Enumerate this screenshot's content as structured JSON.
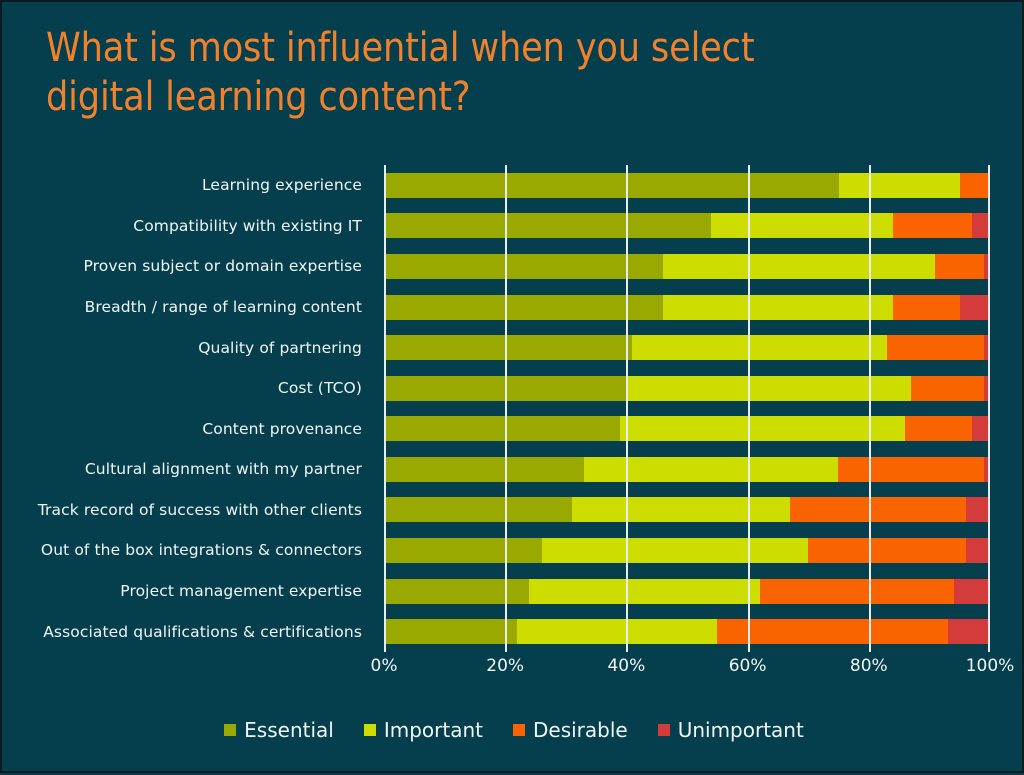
{
  "title": "What is most influential when you select\ndigital learning content?",
  "colors": {
    "background": "#053f4d",
    "title": "#f2812c",
    "text": "#f1f6f7",
    "gridline": "#e8eef0",
    "essential": "#9aa900",
    "important": "#cddd00",
    "desirable": "#fa6400",
    "unimportant": "#d43b3b"
  },
  "legend": [
    {
      "label": "Essential",
      "color": "#9aa900",
      "key": "essential"
    },
    {
      "label": "Important",
      "color": "#cddd00",
      "key": "important"
    },
    {
      "label": "Desirable",
      "color": "#fa6400",
      "key": "desirable"
    },
    {
      "label": "Unimportant",
      "color": "#d43b3b",
      "key": "unimportant"
    }
  ],
  "xticks": [
    "0%",
    "20%",
    "40%",
    "60%",
    "80%",
    "100%"
  ],
  "chart_data": {
    "type": "bar",
    "orientation": "horizontal",
    "stacked": true,
    "normalized": "percent",
    "title": "What is most influential when you select digital learning content?",
    "xlabel": "",
    "ylabel": "",
    "xlim": [
      0,
      100
    ],
    "xticks": [
      0,
      20,
      40,
      60,
      80,
      100
    ],
    "xticklabels": [
      "0%",
      "20%",
      "40%",
      "60%",
      "80%",
      "100%"
    ],
    "grid": "vertical",
    "legend_position": "bottom",
    "categories": [
      "Learning experience",
      "Compatibility with existing IT",
      "Proven subject or domain expertise",
      "Breadth / range of learning content",
      "Quality of partnering",
      "Cost (TCO)",
      "Content provenance",
      "Cultural alignment with my partner",
      "Track record of success with other clients",
      "Out of the box integrations & connectors",
      "Project management expertise",
      "Associated qualifications & certifications"
    ],
    "series": [
      {
        "name": "Essential",
        "color": "#9aa900",
        "values": [
          75,
          54,
          46,
          46,
          41,
          40,
          39,
          33,
          31,
          26,
          24,
          22
        ]
      },
      {
        "name": "Important",
        "color": "#cddd00",
        "values": [
          20,
          30,
          45,
          38,
          42,
          47,
          47,
          42,
          36,
          44,
          38,
          33
        ]
      },
      {
        "name": "Desirable",
        "color": "#fa6400",
        "values": [
          5,
          13,
          8,
          11,
          16,
          12,
          11,
          24,
          29,
          26,
          32,
          38
        ]
      },
      {
        "name": "Unimportant",
        "color": "#d43b3b",
        "values": [
          0,
          3,
          1,
          5,
          1,
          1,
          3,
          1,
          4,
          4,
          6,
          7
        ]
      }
    ]
  }
}
